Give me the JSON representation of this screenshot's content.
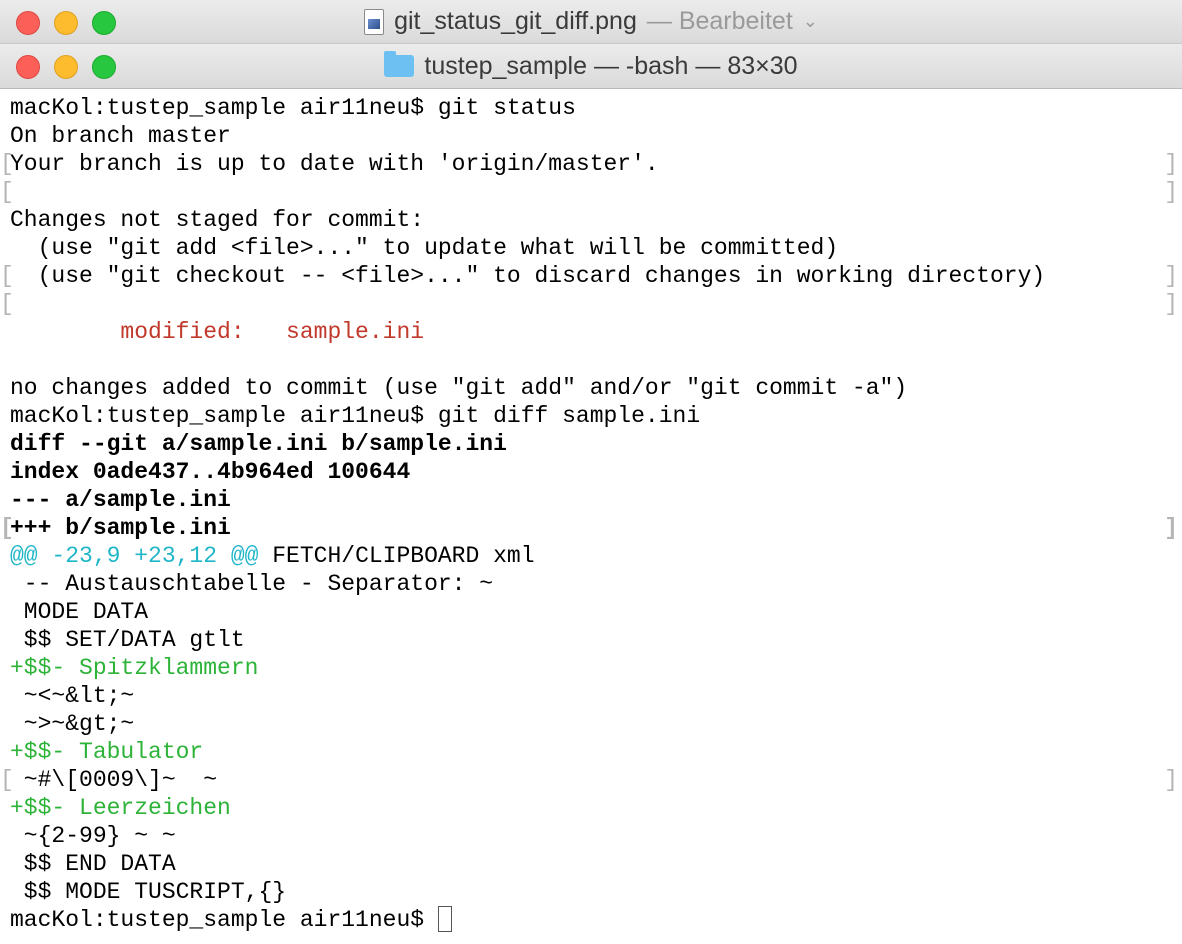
{
  "outer_window": {
    "title": "git_status_git_diff.png",
    "subtitle": "— Bearbeitet",
    "chevron": "⌄"
  },
  "terminal_window": {
    "title": "tustep_sample — -bash — 83×30"
  },
  "terminal": {
    "prompt": "macKol:tustep_sample air11neu$ ",
    "cmd1": "git status",
    "lines": [
      "On branch master",
      "Your branch is up to date with 'origin/master'.",
      "",
      "Changes not staged for commit:",
      "  (use \"git add <file>...\" to update what will be committed)",
      "  (use \"git checkout -- <file>...\" to discard changes in working directory)",
      "",
      "        modified:   sample.ini",
      "",
      "no changes added to commit (use \"git add\" and/or \"git commit -a\")"
    ],
    "cmd2": "git diff sample.ini",
    "diff_header": [
      "diff --git a/sample.ini b/sample.ini",
      "index 0ade437..4b964ed 100644",
      "--- a/sample.ini",
      "+++ b/sample.ini"
    ],
    "hunk_range": "@@ -23,9 +23,12 @@",
    "hunk_context": " FETCH/CLIPBOARD xml",
    "diff_body": [
      " -- Austauschtabelle - Separator: ~",
      " MODE DATA",
      " $$ SET/DATA gtlt",
      "+$$- Spitzklammern",
      " ~<~&lt;~",
      " ~>~&gt;~",
      "+$$- Tabulator",
      " ~#\\[0009\\]~  ~",
      "+$$- Leerzeichen",
      " ~{2-99} ~ ~",
      " $$ END DATA",
      " $$ MODE TUSCRIPT,{}"
    ],
    "mark_left": "[",
    "mark_right": "]"
  },
  "colors": {
    "modified": "#c0392b",
    "added": "#2db338",
    "hunk": "#1fb6c8"
  }
}
